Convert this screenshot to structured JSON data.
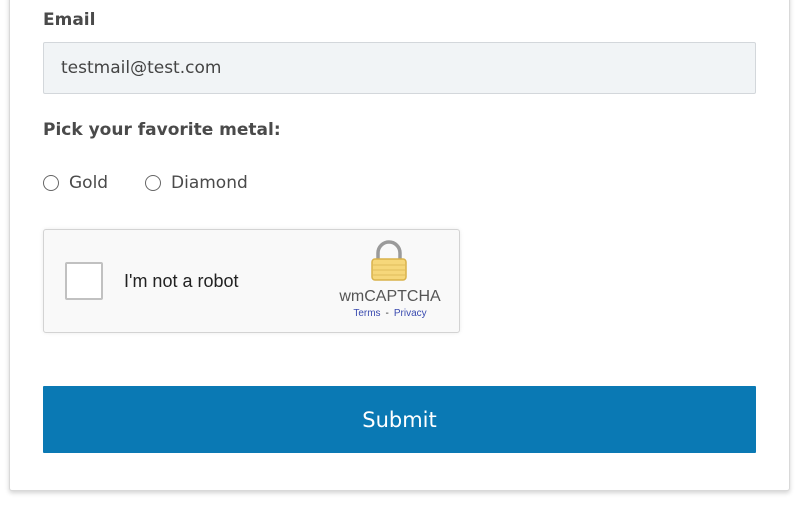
{
  "form": {
    "email_label": "Email",
    "email_value": "testmail@test.com",
    "metal_label": "Pick your favorite metal:",
    "metal_options": [
      {
        "label": "Gold",
        "selected": false
      },
      {
        "label": "Diamond",
        "selected": false
      }
    ],
    "submit_label": "Submit"
  },
  "captcha": {
    "checkbox_text": "I'm not a robot",
    "brand": "wmCAPTCHA",
    "terms_link": "Terms",
    "separator": "-",
    "privacy_link": "Privacy",
    "lock_icon": "lock-icon"
  },
  "colors": {
    "accent": "#0a79b4",
    "input_bg": "#f1f4f6",
    "lock_body": "#f6d77a"
  }
}
